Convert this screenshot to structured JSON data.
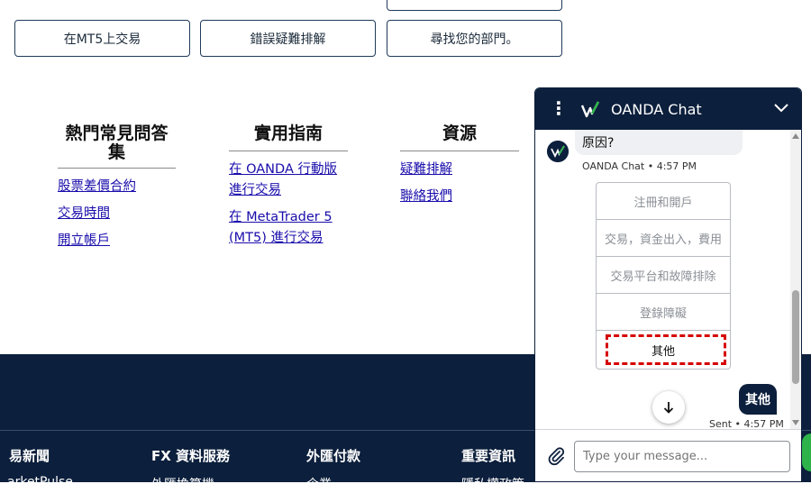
{
  "buttons": {
    "mt5": "在MT5上交易",
    "troubleshoot": "錯誤疑難排解",
    "find_dept": "尋找您的部門。"
  },
  "faq_columns": [
    {
      "title": "熱門常見問答集",
      "links": [
        "股票差價合約",
        "交易時間",
        "開立帳戶"
      ]
    },
    {
      "title": "實用指南",
      "links": [
        "在 OANDA 行動版進行交易",
        "在 MetaTrader 5 (MT5) 進行交易"
      ]
    },
    {
      "title": "資源",
      "links": [
        "疑難排解",
        "聯絡我們"
      ]
    }
  ],
  "footer": {
    "titles": [
      "易新聞",
      "FX 資料服務",
      "外匯付款",
      "重要資訊"
    ],
    "links": [
      "arketPulse",
      "外匯換算機",
      "企業",
      "隱私權政策"
    ]
  },
  "chat": {
    "header_title": "OANDA Chat",
    "incoming_message": "原因?",
    "incoming_meta": "OANDA Chat • 4:57 PM",
    "options": [
      "注冊和開戶",
      "交易，資金出入，費用",
      "交易平台和故障排除",
      "登錄障礙",
      "其他"
    ],
    "outgoing_message": "其他",
    "outgoing_meta": "Sent • 4:57 PM",
    "input_placeholder": "Type your message...",
    "colors": {
      "navy": "#0c1f3c",
      "highlight": "#d60000",
      "green": "#2db34a"
    }
  }
}
